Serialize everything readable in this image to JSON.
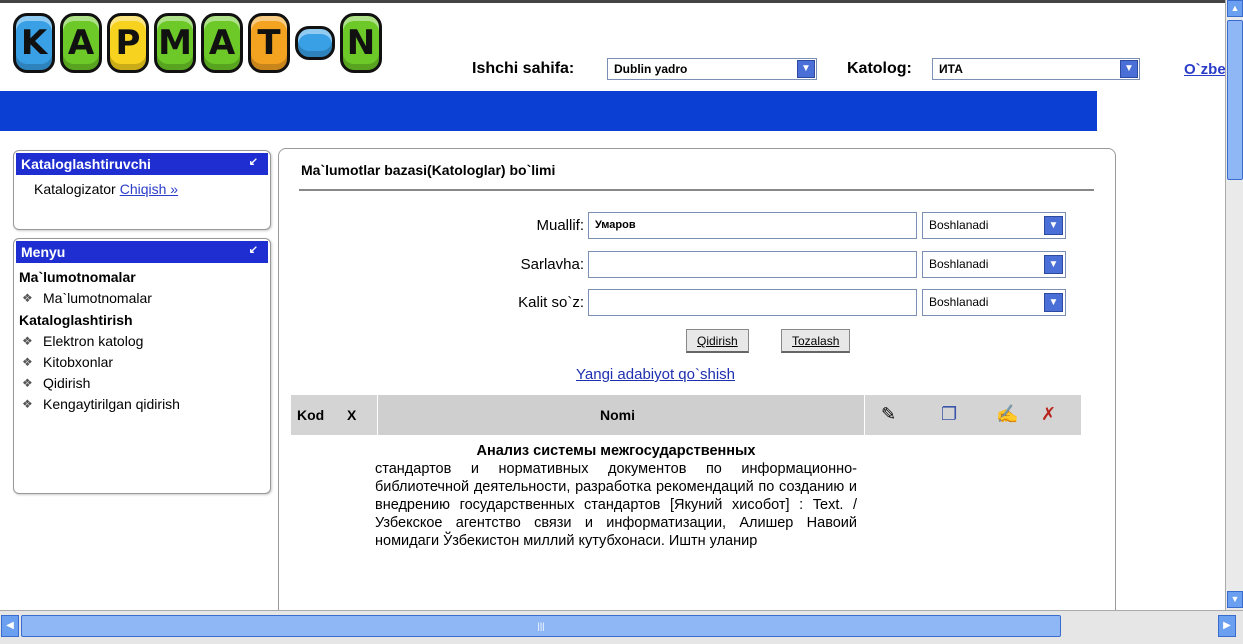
{
  "logo": {
    "tiles": [
      {
        "letter": "K",
        "color": "#3aa0e6"
      },
      {
        "letter": "A",
        "color": "#6cc928"
      },
      {
        "letter": "P",
        "color": "#f7d21e"
      },
      {
        "letter": "M",
        "color": "#6cc928"
      },
      {
        "letter": "A",
        "color": "#6cc928"
      },
      {
        "letter": "T",
        "color": "#f4a321"
      },
      {
        "letter": "",
        "color": "#3aa0e6"
      },
      {
        "letter": "N",
        "color": "#6cc928"
      }
    ]
  },
  "header": {
    "workpage_label": "Ishchi sahifa:",
    "workpage_value": "Dublin yadro",
    "catalog_label": "Katolog:",
    "catalog_value": "ИТА",
    "language_link": "O`zbe"
  },
  "sidebar": {
    "cataloger_title": "Kataloglashtiruvchi",
    "cataloger_user": "Katalogizator",
    "logout_link": "Chiqish »",
    "menu_title": "Menyu",
    "groups": [
      {
        "title": "Ma`lumotnomalar",
        "items": [
          "Ma`lumotnomalar"
        ]
      },
      {
        "title": "Kataloglashtirish",
        "items": [
          "Elektron katolog",
          "Kitobxonlar",
          "Qidirish",
          "Kengaytirilgan qidirish"
        ]
      }
    ]
  },
  "main": {
    "title": "Ma`lumotlar bazasi(Katologlar) bo`limi",
    "fields": [
      {
        "label": "Muallif:",
        "value": "Умаров",
        "mode": "Boshlanadi"
      },
      {
        "label": "Sarlavha:",
        "value": "",
        "mode": "Boshlanadi"
      },
      {
        "label": "Kalit so`z:",
        "value": "",
        "mode": "Boshlanadi"
      }
    ],
    "search_button": "Qidirish",
    "clear_button": "Tozalash",
    "new_link": "Yangi adabiyot qo`shish",
    "table": {
      "col_kod": "Kod",
      "col_x": "X",
      "col_name": "Nomi",
      "row_title": "Анализ системы межгосударственных",
      "row_text": "стандартов и нормативных документов по информационно-библиотечной деятельности, разработка рекомендаций по созданию и внедрению государственных стандартов [Якуний хисобот] : Text. / Узбекское агентство связи и информатизации, Алишер Навоий номидаги Ўзбекистон миллий кутубхонаси. Иштн уланир"
    }
  },
  "icons": {
    "edit": "pencil-icon",
    "copy": "copy-icon",
    "assign": "assign-icon",
    "delete": "delete-icon",
    "menu_item": "books-icon"
  },
  "colors": {
    "header_blue": "#0b3fd4",
    "panel_head": "#1f2ed1",
    "link": "#2a3cc8"
  }
}
